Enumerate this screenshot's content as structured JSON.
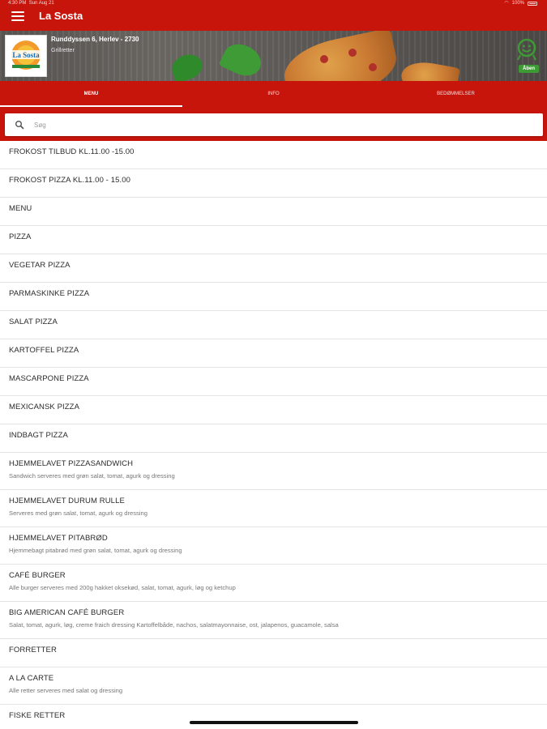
{
  "status_bar": {
    "time": "4:30 PM",
    "date": "Sun Aug 21",
    "battery": "100%"
  },
  "app": {
    "title": "La Sosta"
  },
  "shop": {
    "address": "Runddyssen 6, Herlev - 2730",
    "category": "Grillretter",
    "logo_text": "La Sosta",
    "open_label": "Åben"
  },
  "tabs": [
    {
      "label": "MENU",
      "active": true
    },
    {
      "label": "INFO",
      "active": false
    },
    {
      "label": "BEDØMMELSER",
      "active": false
    }
  ],
  "search": {
    "placeholder": "Søg",
    "value": ""
  },
  "menu_items": [
    {
      "title": "FROKOST TILBUD KL.11.00 -15.00",
      "desc": ""
    },
    {
      "title": "FROKOST PIZZA KL.11.00 - 15.00",
      "desc": ""
    },
    {
      "title": "MENU",
      "desc": ""
    },
    {
      "title": "PIZZA",
      "desc": ""
    },
    {
      "title": "VEGETAR PIZZA",
      "desc": ""
    },
    {
      "title": "PARMASKINKE PIZZA",
      "desc": ""
    },
    {
      "title": "SALAT PIZZA",
      "desc": ""
    },
    {
      "title": "KARTOFFEL PIZZA",
      "desc": ""
    },
    {
      "title": "MASCARPONE PIZZA",
      "desc": ""
    },
    {
      "title": "MEXICANSK PIZZA",
      "desc": ""
    },
    {
      "title": "INDBAGT PIZZA",
      "desc": ""
    },
    {
      "title": "HJEMMELAVET PIZZASANDWICH",
      "desc": "Sandwich serveres med grøn salat, tomat, agurk og dressing"
    },
    {
      "title": "HJEMMELAVET DURUM RULLE",
      "desc": "Serveres med grøn salat, tomat, agurk og dressing"
    },
    {
      "title": "HJEMMELAVET PITABRØD",
      "desc": "Hjemmebagt pitabrød med grøn salat, tomat, agurk og dressing"
    },
    {
      "title": "CAFÉ BURGER",
      "desc": "Alle burger serveres med 200g hakket oksekød, salat, tomat, agurk, løg og ketchup"
    },
    {
      "title": "BIG AMERICAN CAFÉ BURGER",
      "desc": "Salat, tomat, agurk, løg, creme fraich dressing Kartoffelbåde, nachos, salatmayonnaise, ost, jalapenos, guacamole, salsa"
    },
    {
      "title": "FORRETTER",
      "desc": ""
    },
    {
      "title": "A LA CARTE",
      "desc": "Alle retter serveres med salat og dressing"
    },
    {
      "title": "FISKE RETTER",
      "desc": ""
    }
  ],
  "colors": {
    "brand_red": "#c8150c",
    "open_green": "#3d9a34"
  },
  "icons": [
    "hamburger-menu-icon",
    "open-status-icon",
    "search-icon"
  ]
}
